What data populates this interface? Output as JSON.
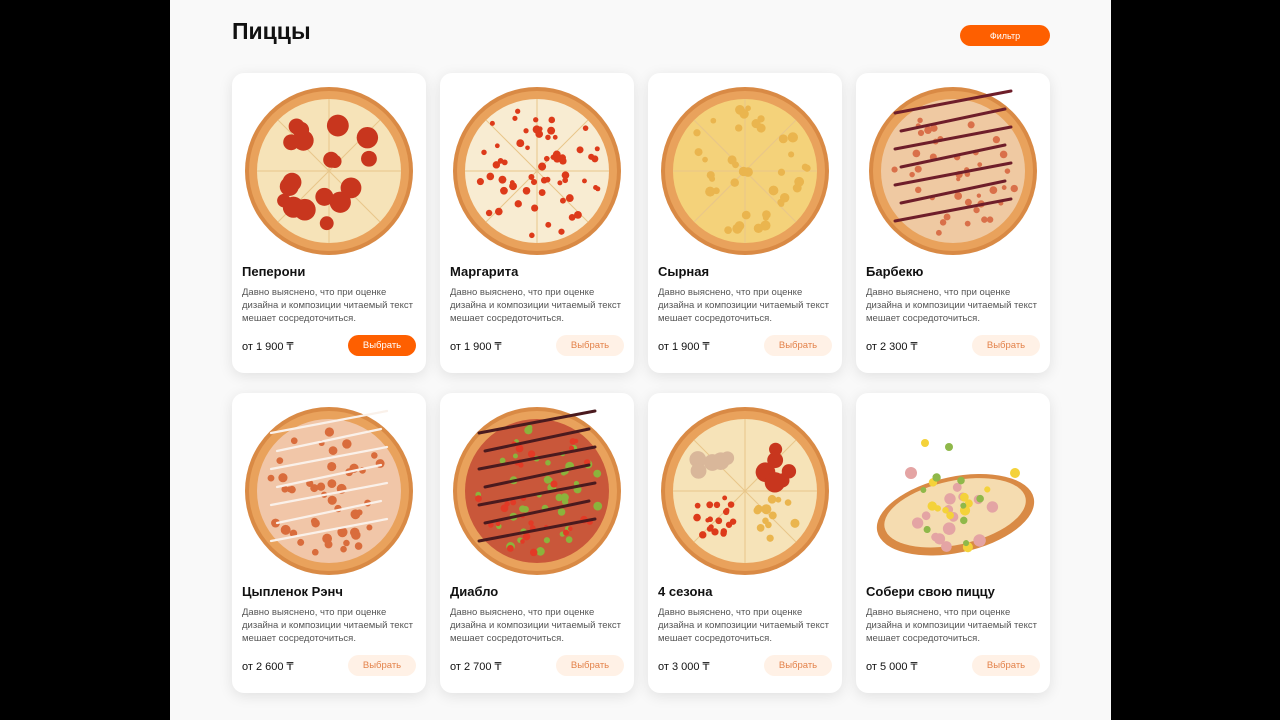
{
  "header": {
    "title": "Пиццы",
    "filter_label": "Фильтр"
  },
  "colors": {
    "accent": "#fe5f00",
    "button_soft_bg": "#fff1e6",
    "button_soft_text": "#e3824a",
    "page_bg": "#f9f9f9"
  },
  "products": [
    {
      "name": "Пеперони",
      "description": "Давно выяснено, что при оценке дизайна и композиции читаемый текст мешает сосредоточиться.",
      "price": "от 1 900 ₸",
      "button": "Выбрать",
      "image": "pepperoni-pizza"
    },
    {
      "name": "Маргарита",
      "description": "Давно выяснено, что при оценке дизайна и композиции читаемый текст мешает сосредоточиться.",
      "price": "от 1 900 ₸",
      "button": "Выбрать",
      "image": "margherita-pizza"
    },
    {
      "name": "Сырная",
      "description": "Давно выяснено, что при оценке дизайна и композиции читаемый текст мешает сосредоточиться.",
      "price": "от 1 900 ₸",
      "button": "Выбрать",
      "image": "cheese-pizza"
    },
    {
      "name": "Барбекю",
      "description": "Давно выяснено, что при оценке дизайна и композиции читаемый текст мешает сосредоточиться.",
      "price": "от 2 300 ₸",
      "button": "Выбрать",
      "image": "bbq-pizza"
    },
    {
      "name": "Цыпленок Рэнч",
      "description": "Давно выяснено, что при оценке дизайна и композиции читаемый текст мешает сосредоточиться.",
      "price": "от 2 600 ₸",
      "button": "Выбрать",
      "image": "chicken-ranch-pizza"
    },
    {
      "name": "Диабло",
      "description": "Давно выяснено, что при оценке дизайна и композиции читаемый текст мешает сосредоточиться.",
      "price": "от 2 700 ₸",
      "button": "Выбрать",
      "image": "diablo-pizza"
    },
    {
      "name": "4 сезона",
      "description": "Давно выяснено, что при оценке дизайна и композиции читаемый текст мешает сосредоточиться.",
      "price": "от 3 000 ₸",
      "button": "Выбрать",
      "image": "four-seasons-pizza"
    },
    {
      "name": "Собери свою пиццу",
      "description": "Давно выяснено, что при оценке дизайна и композиции читаемый текст мешает сосредоточиться.",
      "price": "от 5 000 ₸",
      "button": "Выбрать",
      "image": "custom-pizza"
    }
  ]
}
